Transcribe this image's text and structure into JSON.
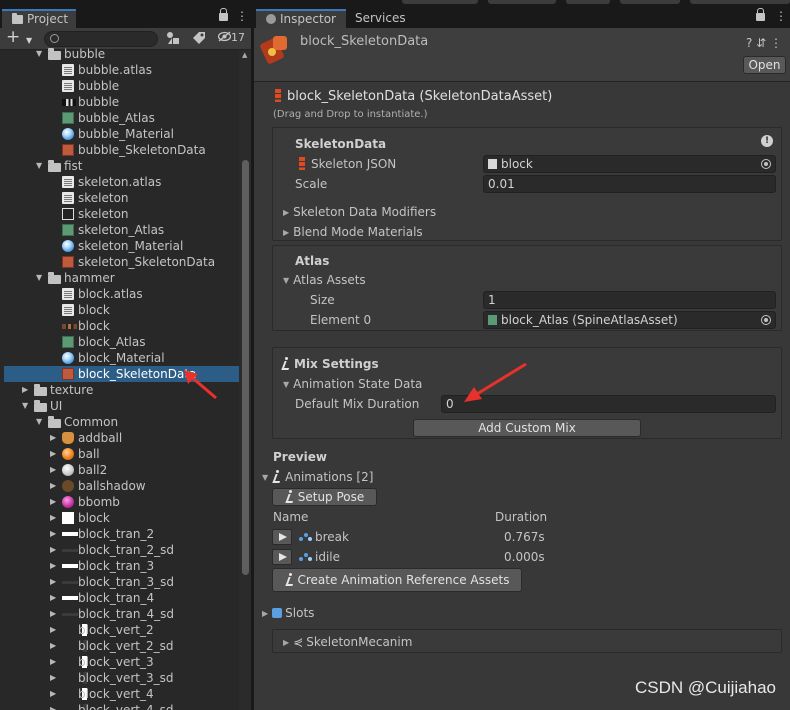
{
  "project": {
    "tab_label": "Project",
    "tab_tools": [
      "🔒",
      "⋮"
    ],
    "hidden_count": "17",
    "search_placeholder": "",
    "tree": [
      {
        "label": "bubble",
        "kind": "folder",
        "depth": 1,
        "expanded": true
      },
      {
        "label": "bubble.atlas",
        "kind": "file",
        "depth": 2
      },
      {
        "label": "bubble",
        "kind": "file",
        "depth": 2
      },
      {
        "label": "bubble",
        "kind": "tex",
        "depth": 2
      },
      {
        "label": "bubble_Atlas",
        "kind": "atlas",
        "depth": 2
      },
      {
        "label": "bubble_Material",
        "kind": "mat",
        "depth": 2
      },
      {
        "label": "bubble_SkeletonData",
        "kind": "skel",
        "depth": 2
      },
      {
        "label": "fist",
        "kind": "folder",
        "depth": 1,
        "expanded": true
      },
      {
        "label": "skeleton.atlas",
        "kind": "file",
        "depth": 2
      },
      {
        "label": "skeleton",
        "kind": "file",
        "depth": 2
      },
      {
        "label": "skeleton",
        "kind": "tex2",
        "depth": 2
      },
      {
        "label": "skeleton_Atlas",
        "kind": "atlas",
        "depth": 2
      },
      {
        "label": "skeleton_Material",
        "kind": "mat",
        "depth": 2
      },
      {
        "label": "skeleton_SkeletonData",
        "kind": "skel",
        "depth": 2
      },
      {
        "label": "hammer",
        "kind": "folder",
        "depth": 1,
        "expanded": true
      },
      {
        "label": "block.atlas",
        "kind": "file",
        "depth": 2
      },
      {
        "label": "block",
        "kind": "file",
        "depth": 2
      },
      {
        "label": "block",
        "kind": "tex3",
        "depth": 2
      },
      {
        "label": "block_Atlas",
        "kind": "atlas",
        "depth": 2
      },
      {
        "label": "block_Material",
        "kind": "mat",
        "depth": 2
      },
      {
        "label": "block_SkeletonData",
        "kind": "skel",
        "depth": 2,
        "selected": true
      },
      {
        "label": "texture",
        "kind": "folder",
        "depth": 0,
        "expanded": false
      },
      {
        "label": "UI",
        "kind": "folder",
        "depth": 0,
        "expanded": true
      },
      {
        "label": "Common",
        "kind": "folder",
        "depth": 1,
        "expanded": true
      },
      {
        "label": "addball",
        "kind": "sprite-add",
        "depth": 2,
        "expandable": true
      },
      {
        "label": "ball",
        "kind": "ball",
        "depth": 2,
        "expandable": true
      },
      {
        "label": "ball2",
        "kind": "ball2",
        "depth": 2,
        "expandable": true
      },
      {
        "label": "ballshadow",
        "kind": "shadow",
        "depth": 2,
        "expandable": true
      },
      {
        "label": "bbomb",
        "kind": "bomb",
        "depth": 2,
        "expandable": true
      },
      {
        "label": "block",
        "kind": "white",
        "depth": 2,
        "expandable": true
      },
      {
        "label": "block_tran_2",
        "kind": "hbar",
        "depth": 2,
        "expandable": true
      },
      {
        "label": "block_tran_2_sd",
        "kind": "hbar-sd",
        "depth": 2,
        "expandable": true
      },
      {
        "label": "block_tran_3",
        "kind": "hbar",
        "depth": 2,
        "expandable": true
      },
      {
        "label": "block_tran_3_sd",
        "kind": "hbar-sd",
        "depth": 2,
        "expandable": true
      },
      {
        "label": "block_tran_4",
        "kind": "hbar",
        "depth": 2,
        "expandable": true
      },
      {
        "label": "block_tran_4_sd",
        "kind": "hbar-sd",
        "depth": 2,
        "expandable": true
      },
      {
        "label": "block_vert_2",
        "kind": "vbar",
        "depth": 2,
        "expandable": true
      },
      {
        "label": "block_vert_2_sd",
        "kind": "vbar-sd",
        "depth": 2,
        "expandable": true
      },
      {
        "label": "block_vert_3",
        "kind": "vbar",
        "depth": 2,
        "expandable": true
      },
      {
        "label": "block_vert_3_sd",
        "kind": "vbar-sd",
        "depth": 2,
        "expandable": true
      },
      {
        "label": "block_vert_4",
        "kind": "vbar",
        "depth": 2,
        "expandable": true
      },
      {
        "label": "block_vert_4_sd",
        "kind": "vbar-sd",
        "depth": 2,
        "expandable": true
      }
    ]
  },
  "inspector": {
    "tabs": [
      "Inspector",
      "Services"
    ],
    "asset_name": "block_SkeletonData",
    "header_tools": "? ⇵ ⋮",
    "open_label": "Open",
    "component_title": "block_SkeletonData (SkeletonDataAsset)",
    "drag_hint": "(Drag and Drop to instantiate.)",
    "skeleton_data": {
      "heading": "SkeletonData",
      "json_label": "Skeleton JSON",
      "json_value": "block",
      "scale_label": "Scale",
      "scale_value": "0.01",
      "modifiers_label": "Skeleton Data Modifiers",
      "blend_label": "Blend Mode Materials",
      "warn": "!"
    },
    "atlas": {
      "heading": "Atlas",
      "assets_label": "Atlas Assets",
      "size_label": "Size",
      "size_value": "1",
      "element_label": "Element 0",
      "element_value": "block_Atlas (SpineAtlasAsset)"
    },
    "mix": {
      "heading": "Mix Settings",
      "state_label": "Animation State Data",
      "duration_label": "Default Mix Duration",
      "duration_value": "0",
      "add_button": "Add Custom Mix"
    },
    "preview": {
      "heading": "Preview",
      "animations_label": "Animations [2]",
      "setup_pose": "Setup Pose",
      "col_name": "Name",
      "col_duration": "Duration",
      "animations": [
        {
          "name": "break",
          "duration": "0.767s"
        },
        {
          "name": "idile",
          "duration": "0.000s"
        }
      ],
      "create_button": "Create Animation Reference Assets"
    },
    "slots_label": "Slots",
    "mecanim_label": "SkeletonMecanim"
  },
  "watermark": "CSDN @Cuijiahao",
  "colors": {
    "selection": "#2c5d87",
    "accent_arrow": "#e8312a",
    "panel": "#383838"
  }
}
